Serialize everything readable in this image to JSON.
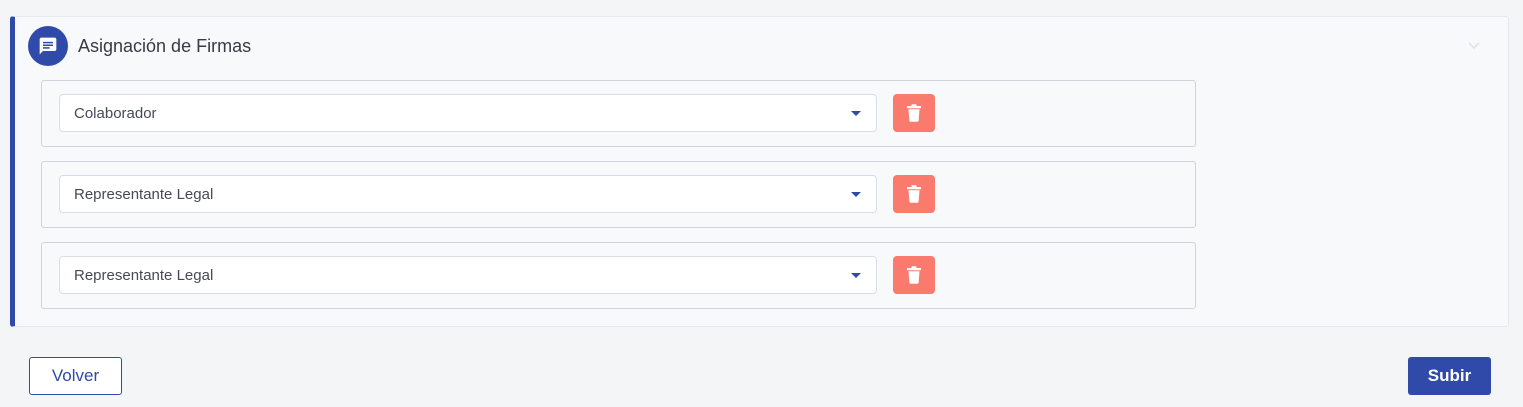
{
  "section": {
    "title": "Asignación de Firmas",
    "icon": "chat-message-icon",
    "collapse_icon": "chevron-down-icon",
    "accent_color": "#2f4aa8"
  },
  "signers": [
    {
      "role": "Colaborador"
    },
    {
      "role": "Representante Legal"
    },
    {
      "role": "Representante Legal"
    }
  ],
  "delete_icon": "trash-icon",
  "delete_color": "#fa7a6e",
  "actions": {
    "back_label": "Volver",
    "submit_label": "Subir"
  }
}
